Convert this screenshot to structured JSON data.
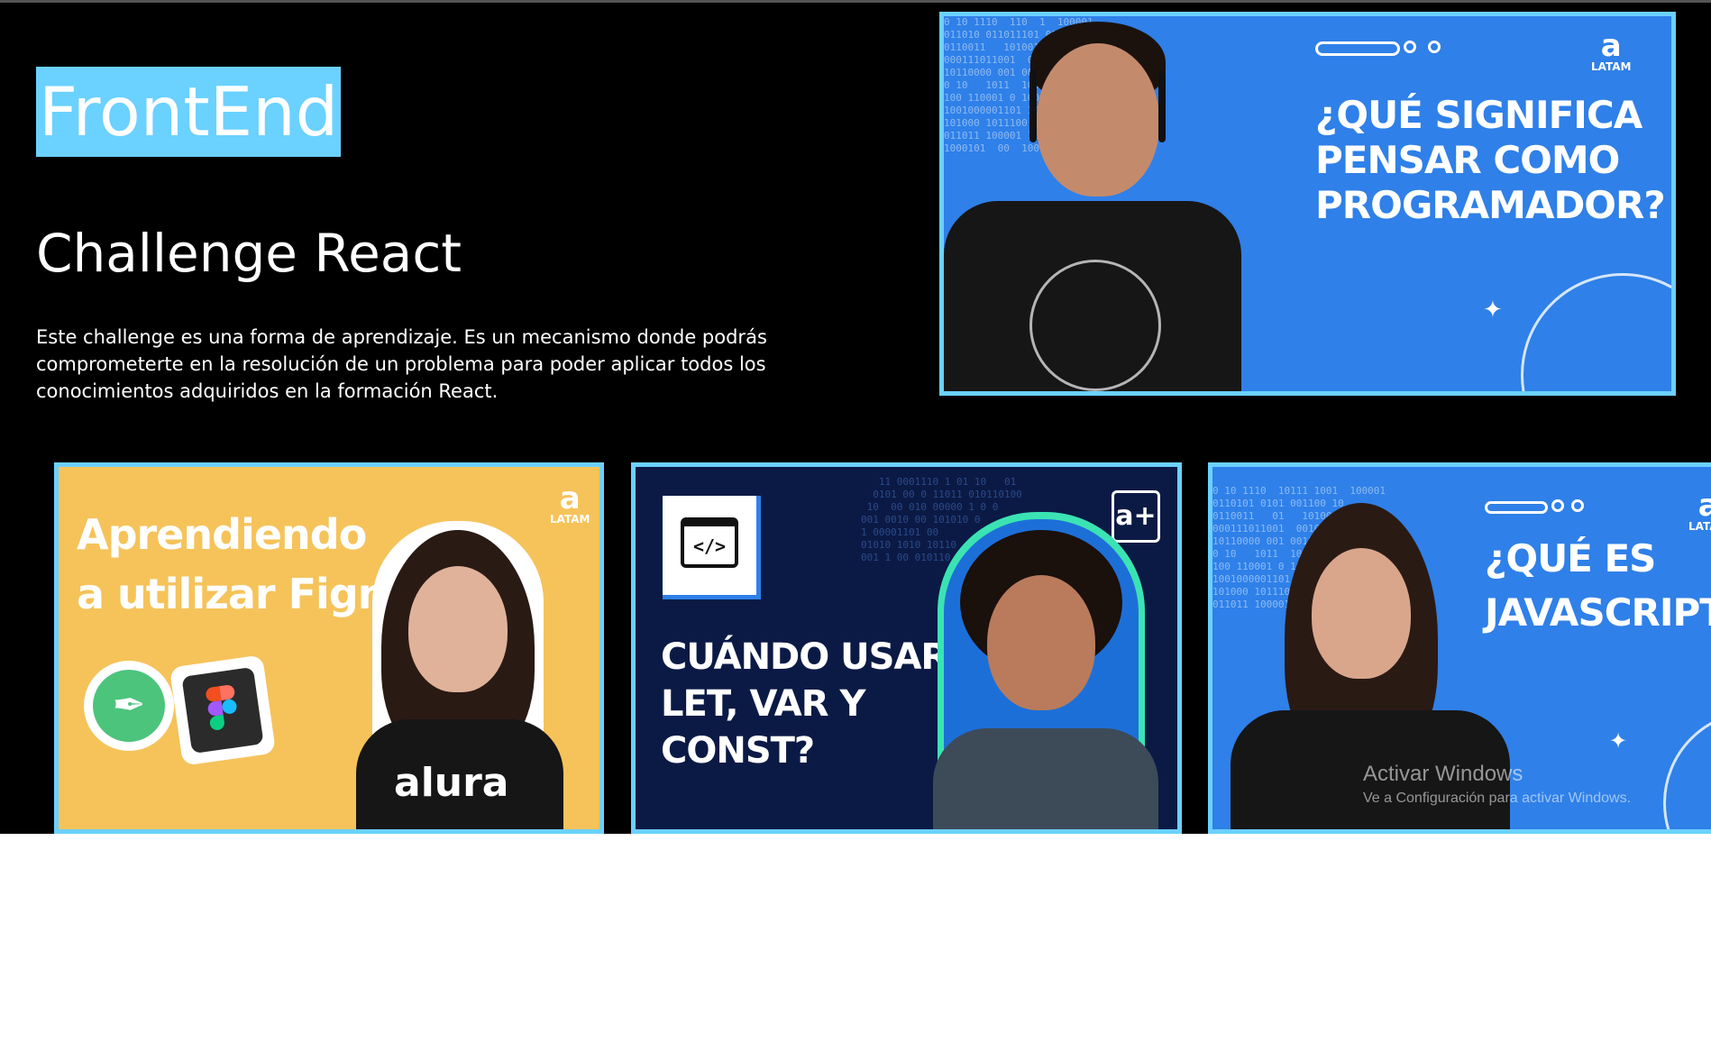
{
  "banner": {
    "category": "FrontEnd",
    "title": "Challenge React",
    "description": "Este challenge es una forma de aprendizaje. Es un mecanismo donde podrás comprometerte en la resolución de un problema para poder aplicar todos los conocimientos adquiridos en la formación React."
  },
  "featured_video": {
    "thumbnail_text": "¿QUÉ SIGNIFICA\nPENSAR COMO\nPROGRAMADOR?",
    "logo_text": "LATAM",
    "icon": "video-thumbnail"
  },
  "videos": [
    {
      "thumbnail_text": "Aprendiendo\na utilizar Figma",
      "logo_text": "LATAM",
      "shirt_text": "alura"
    },
    {
      "thumbnail_text": "CUÁNDO USAR\nLET, VAR Y\nCONST?",
      "logo_text": "a+"
    },
    {
      "thumbnail_text": "¿QUÉ ES\nJAVASCRIPT?",
      "logo_text": "LATAM"
    }
  ],
  "windows_watermark": {
    "line1": "Activar Windows",
    "line2": "Ve a Configuración para activar Windows."
  },
  "colors": {
    "accent": "#6bd1ff",
    "background": "#000000",
    "thumbnail_blue": "#2f80e8",
    "thumbnail_yellow": "#f5c35a",
    "thumbnail_navy": "#0b1a45"
  }
}
